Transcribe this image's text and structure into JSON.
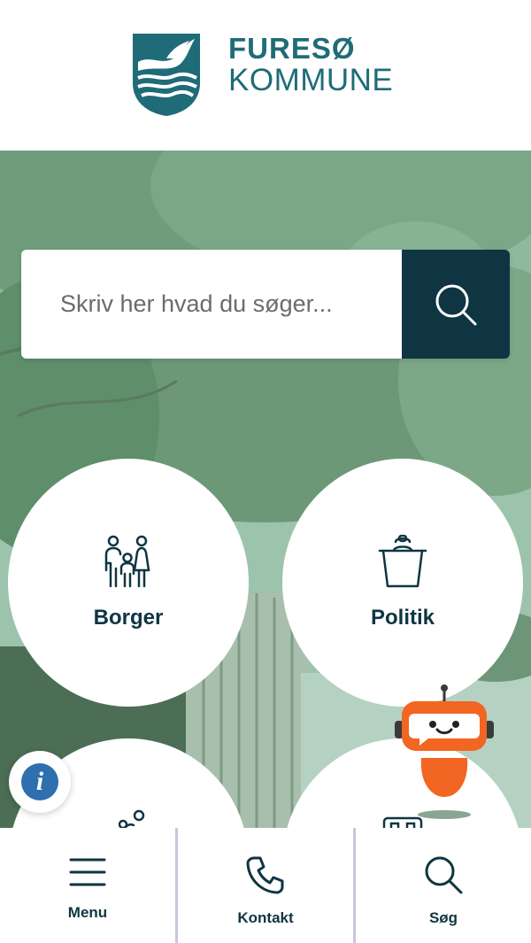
{
  "header": {
    "logo_line1": "FURESØ",
    "logo_line2": "KOMMUNE",
    "logo_icon": "furesoe-shield-icon",
    "brand_color": "#1f6c78"
  },
  "search": {
    "placeholder": "Skriv her hvad du søger...",
    "button_icon": "search-icon",
    "button_color": "#0f3542"
  },
  "tiles": [
    {
      "label": "Borger",
      "icon": "family-icon"
    },
    {
      "label": "Politik",
      "icon": "bin-icon"
    },
    {
      "label": "",
      "icon": "people-icon"
    },
    {
      "label": "",
      "icon": "building-icon"
    }
  ],
  "info_button": {
    "icon": "info-icon",
    "text": "i",
    "color": "#2e6fb0"
  },
  "chatbot": {
    "icon": "robot-icon",
    "color": "#f26522"
  },
  "bottom_nav": [
    {
      "label": "Menu",
      "icon": "hamburger-icon"
    },
    {
      "label": "Kontakt",
      "icon": "phone-icon"
    },
    {
      "label": "Søg",
      "icon": "search-icon"
    }
  ]
}
